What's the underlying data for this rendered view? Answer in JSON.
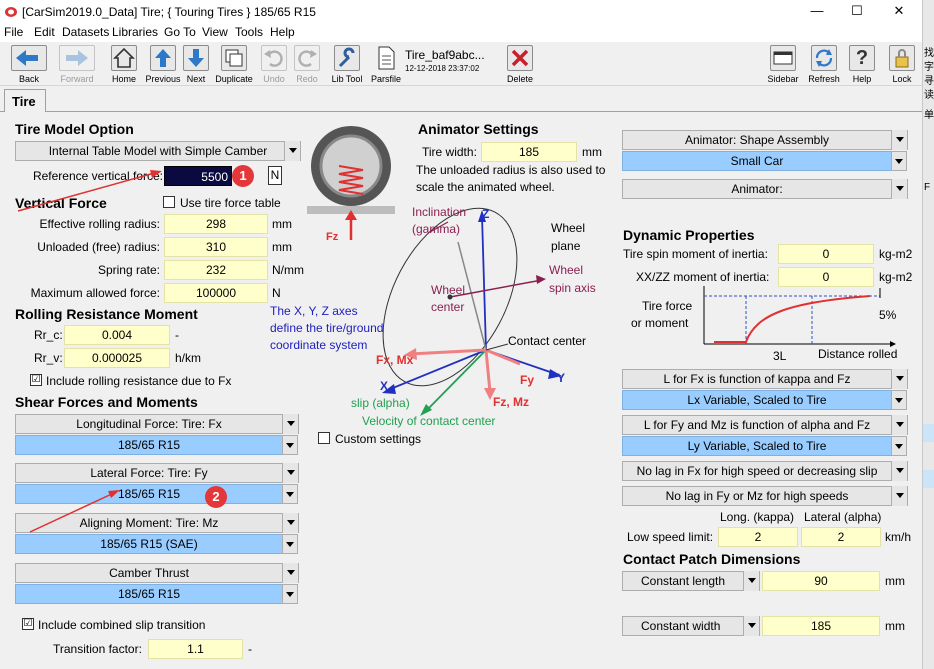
{
  "window": {
    "title": "[CarSim2019.0_Data] Tire; { Touring Tires } 185/65 R15",
    "min": "—",
    "max": "☐",
    "close": "✕"
  },
  "menu": [
    "File",
    "Edit",
    "Datasets",
    "Libraries",
    "Go To",
    "View",
    "Tools",
    "Help"
  ],
  "toolbar": {
    "back": "Back",
    "forward": "Forward",
    "home": "Home",
    "previous": "Previous",
    "next": "Next",
    "duplicate": "Duplicate",
    "undo": "Undo",
    "redo": "Redo",
    "libtool": "Lib Tool",
    "parsfile": "Parsfile",
    "dataset_name": "Tire_baf9abc...",
    "dataset_date": "12-12-2018 23:37:02",
    "delete": "Delete",
    "sidebar": "Sidebar",
    "refresh": "Refresh",
    "help": "Help",
    "lock": "Lock"
  },
  "tab": "Tire",
  "tire_model": {
    "heading": "Tire Model Option",
    "option": "Internal Table Model with Simple Camber",
    "ref_force_label": "Reference vertical force:",
    "ref_force_value": "5500",
    "ref_force_unit": "N"
  },
  "vertical": {
    "heading": "Vertical Force",
    "use_table_label": "Use tire force table",
    "eff_radius_label": "Effective rolling radius:",
    "eff_radius": "298",
    "eff_radius_unit": "mm",
    "unloaded_label": "Unloaded (free) radius:",
    "unloaded": "310",
    "unloaded_unit": "mm",
    "spring_label": "Spring rate:",
    "spring": "232",
    "spring_unit": "N/mm",
    "maxforce_label": "Maximum allowed force:",
    "maxforce": "100000",
    "maxforce_unit": "N"
  },
  "rolling": {
    "heading": "Rolling Resistance Moment",
    "rrc_label": "Rr_c:",
    "rrc": "0.004",
    "rrc_unit": "-",
    "rrv_label": "Rr_v:",
    "rrv": "0.000025",
    "rrv_unit": "h/km",
    "include_label": "Include rolling resistance due to Fx",
    "include_checked": "☑"
  },
  "shear": {
    "heading": "Shear Forces and Moments",
    "long_label": "Longitudinal Force: Tire: Fx",
    "long_value": "185/65 R15",
    "lat_label": "Lateral Force: Tire: Fy",
    "lat_value": "185/65 R15",
    "align_label": "Aligning Moment: Tire: Mz",
    "align_value": "185/65 R15 (SAE)",
    "camber_label": "Camber Thrust",
    "camber_value": "185/65 R15",
    "combined_label": "Include combined slip transition",
    "combined_checked": "☑",
    "trans_label": "Transition factor:",
    "trans_value": "1.1",
    "trans_unit": "-"
  },
  "animator": {
    "heading": "Animator Settings",
    "width_label": "Tire width:",
    "width": "185",
    "width_unit": "mm",
    "note1": "The unloaded radius is also used to",
    "note2": "scale the animated wheel.",
    "shape_label": "Animator: Shape Assembly",
    "shape_value": "Small Car",
    "animator_label": "Animator:"
  },
  "diagram": {
    "fz": "Fz",
    "inclination1": "Inclination",
    "inclination2": "(gamma)",
    "z": "Z",
    "wheel_plane1": "Wheel",
    "wheel_plane2": "plane",
    "wheel_spin1": "Wheel",
    "wheel_spin2": "spin axis",
    "wheel_center1": "Wheel",
    "wheel_center2": "center",
    "axes1": "The X, Y, Z axes",
    "axes2": "define the tire/ground",
    "axes3": "coordinate system",
    "contact": "Contact center",
    "fxmx": "Fx, Mx",
    "fy": "Fy",
    "y": "Y",
    "x": "X",
    "fzmz": "Fz, Mz",
    "slip": "slip (alpha)",
    "velocity": "Velocity of contact center",
    "custom_label": "Custom settings"
  },
  "dynamic": {
    "heading": "Dynamic Properties",
    "spin_label": "Tire spin moment of inertia:",
    "spin": "0",
    "spin_unit": "kg-m2",
    "xxzz_label": "XX/ZZ moment of inertia:",
    "xxzz": "0",
    "xxzz_unit": "kg-m2",
    "force_label1": "Tire force",
    "force_label2": "or moment",
    "pct": "5%",
    "three_l": "3L",
    "distance": "Distance rolled",
    "lfx_label": "L for Fx is function of kappa and Fz",
    "lfx_value": "Lx Variable, Scaled to Tire",
    "lfy_label": "L for Fy and Mz is function of alpha and Fz",
    "lfy_value": "Ly Variable, Scaled to Tire",
    "nolag_fx": "No lag in Fx for high speed or decreasing slip",
    "nolag_fy": "No lag in Fy or Mz for high speeds",
    "long_head": "Long. (kappa)",
    "lat_head": "Lateral (alpha)",
    "low_label": "Low speed limit:",
    "low_long": "2",
    "low_lat": "2",
    "low_unit": "km/h"
  },
  "contact_patch": {
    "heading": "Contact Patch Dimensions",
    "length_mode": "Constant length",
    "length": "90",
    "length_unit": "mm",
    "width_mode": "Constant width",
    "width": "185",
    "width_unit": "mm"
  },
  "annotations": {
    "badge1": "1",
    "badge2": "2"
  },
  "side_chars": [
    "找",
    "字",
    "寻",
    "读",
    "单",
    "F"
  ]
}
